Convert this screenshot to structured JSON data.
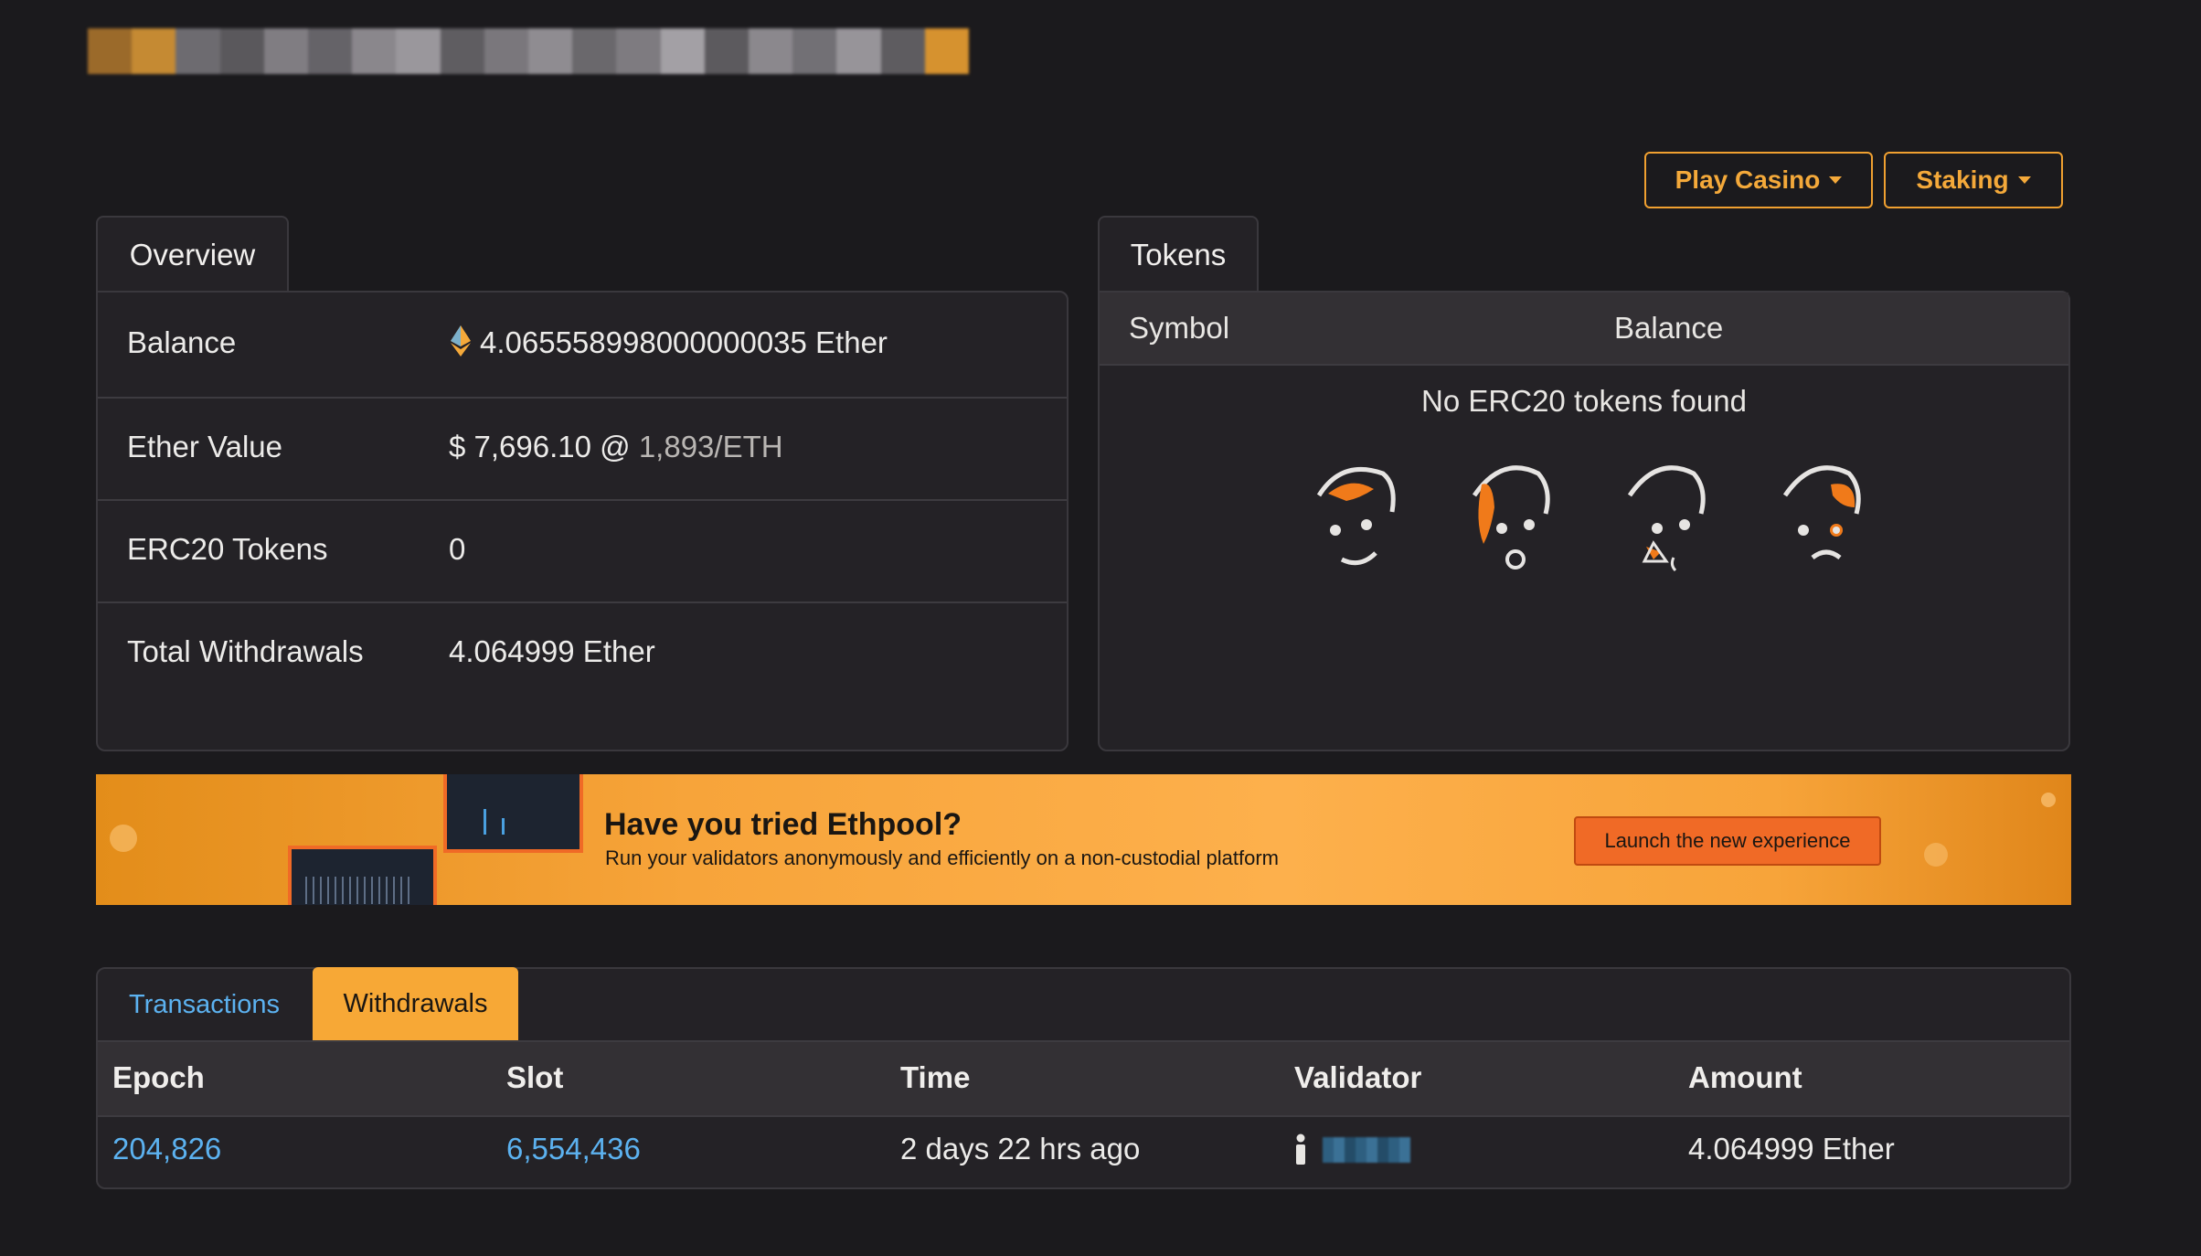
{
  "header": {
    "address_redacted_colors": [
      "#9b6a2a",
      "#c58a33",
      "#6d6b70",
      "#5a585c",
      "#807d82",
      "#656368",
      "#8a878c",
      "#9a979c",
      "#5f5d61",
      "#7a777c",
      "#8f8c91",
      "#6a686c",
      "#7e7b80",
      "#a3a0a5",
      "#5c5a5e",
      "#8b888d",
      "#727075",
      "#979499",
      "#5e5c60",
      "#d6922f"
    ]
  },
  "actions": {
    "play_casino": "Play Casino",
    "staking": "Staking"
  },
  "overview": {
    "tab_label": "Overview",
    "rows": [
      {
        "label": "Balance",
        "value": "4.065558998000000035 Ether",
        "icon": "ethereum-icon"
      },
      {
        "label": "Ether Value",
        "value": "$ 7,696.10 @",
        "value_muted": "1,893/ETH"
      },
      {
        "label": "ERC20 Tokens",
        "value": "0"
      },
      {
        "label": "Total Withdrawals",
        "value": "4.064999 Ether"
      }
    ]
  },
  "tokens": {
    "tab_label": "Tokens",
    "col_symbol": "Symbol",
    "col_balance": "Balance",
    "empty_message": "No ERC20 tokens found"
  },
  "banner": {
    "title": "Have you tried Ethpool?",
    "subtitle": "Run your validators anonymously and efficiently on a non-custodial platform",
    "button": "Launch the new experience"
  },
  "activity": {
    "tabs": [
      {
        "label": "Transactions",
        "active": false
      },
      {
        "label": "Withdrawals",
        "active": true
      }
    ],
    "columns": [
      "Epoch",
      "Slot",
      "Time",
      "Validator",
      "Amount"
    ],
    "rows": [
      {
        "epoch": "204,826",
        "slot": "6,554,436",
        "time": "2 days 22 hrs ago",
        "validator_icon": "person-icon",
        "amount": "4.064999 Ether"
      }
    ]
  },
  "colors": {
    "accent_orange": "#f4a93a",
    "link_blue": "#5cb2f0",
    "background": "#1b1a1d"
  }
}
